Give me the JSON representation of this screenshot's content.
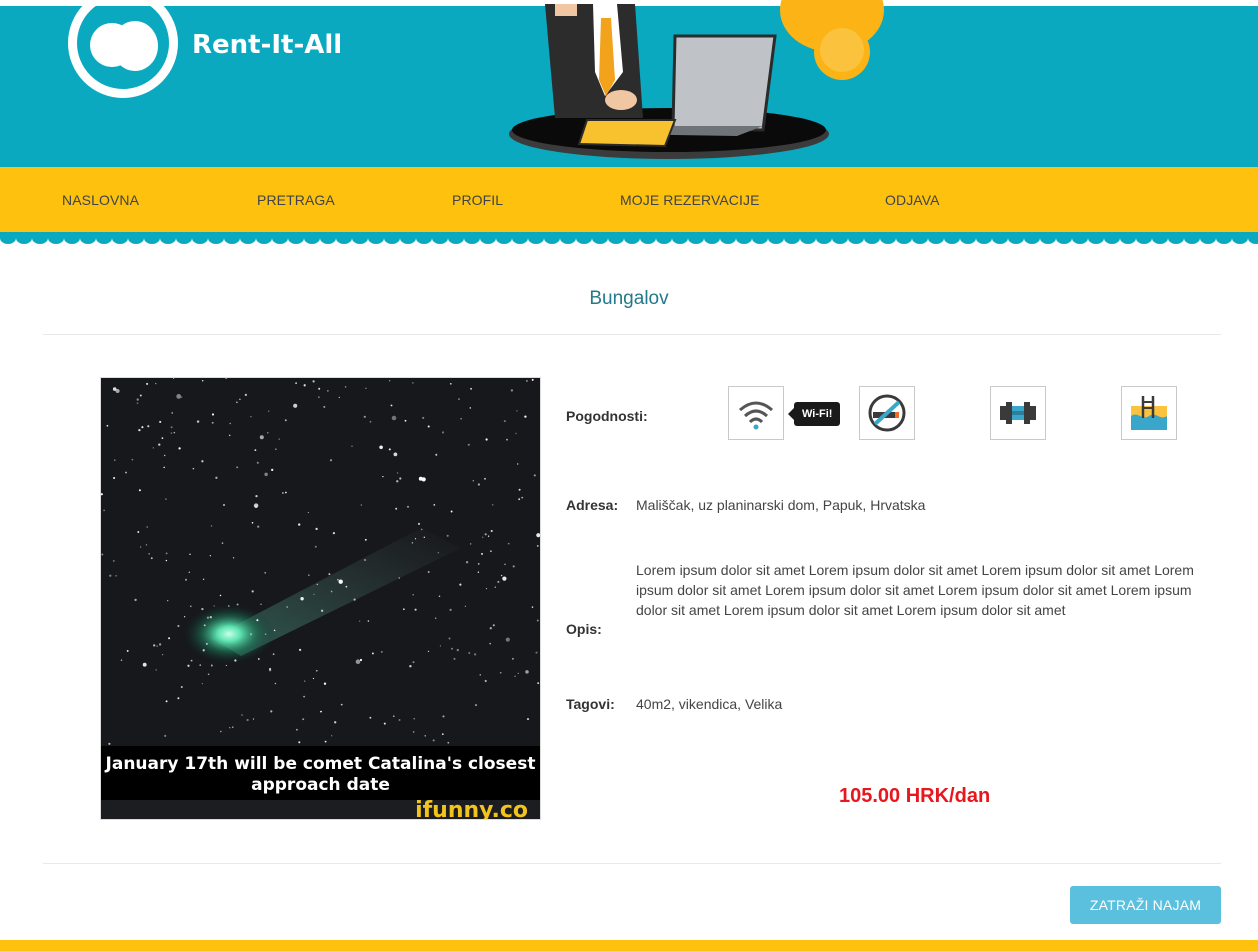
{
  "header": {
    "brand": "Rent-It-All",
    "colors": {
      "teal": "#0aa9bf",
      "yellow": "#fec10d"
    }
  },
  "nav": {
    "items": [
      "NASLOVNA",
      "PRETRAGA",
      "PROFIL",
      "MOJE REZERVACIJE",
      "ODJAVA"
    ]
  },
  "listing": {
    "title": "Bungalov",
    "photo": {
      "caption": "January 17th will be comet Catalina's closest approach date",
      "watermark": "ifunny.co"
    },
    "amenities_label": "Pogodnosti:",
    "amenities": [
      {
        "icon": "wifi-icon",
        "tooltip": "Wi-Fi!"
      },
      {
        "icon": "no-smoking-icon"
      },
      {
        "icon": "gym-icon"
      },
      {
        "icon": "pool-icon"
      }
    ],
    "address_label": "Adresa:",
    "address": "Mališčak, uz planinarski dom, Papuk, Hrvatska",
    "description_label": "Opis:",
    "description": "Lorem ipsum dolor sit amet Lorem ipsum dolor sit amet Lorem ipsum dolor sit amet Lorem ipsum dolor sit amet Lorem ipsum dolor sit amet Lorem ipsum dolor sit amet Lorem ipsum dolor sit amet Lorem ipsum dolor sit amet Lorem ipsum dolor sit amet",
    "tags_label": "Tagovi:",
    "tags": "40m2, vikendica, Velika",
    "price": "105.00 HRK/dan",
    "price_color": "#e8161d"
  },
  "actions": {
    "request_label": "ZATRAŽI NAJAM"
  }
}
